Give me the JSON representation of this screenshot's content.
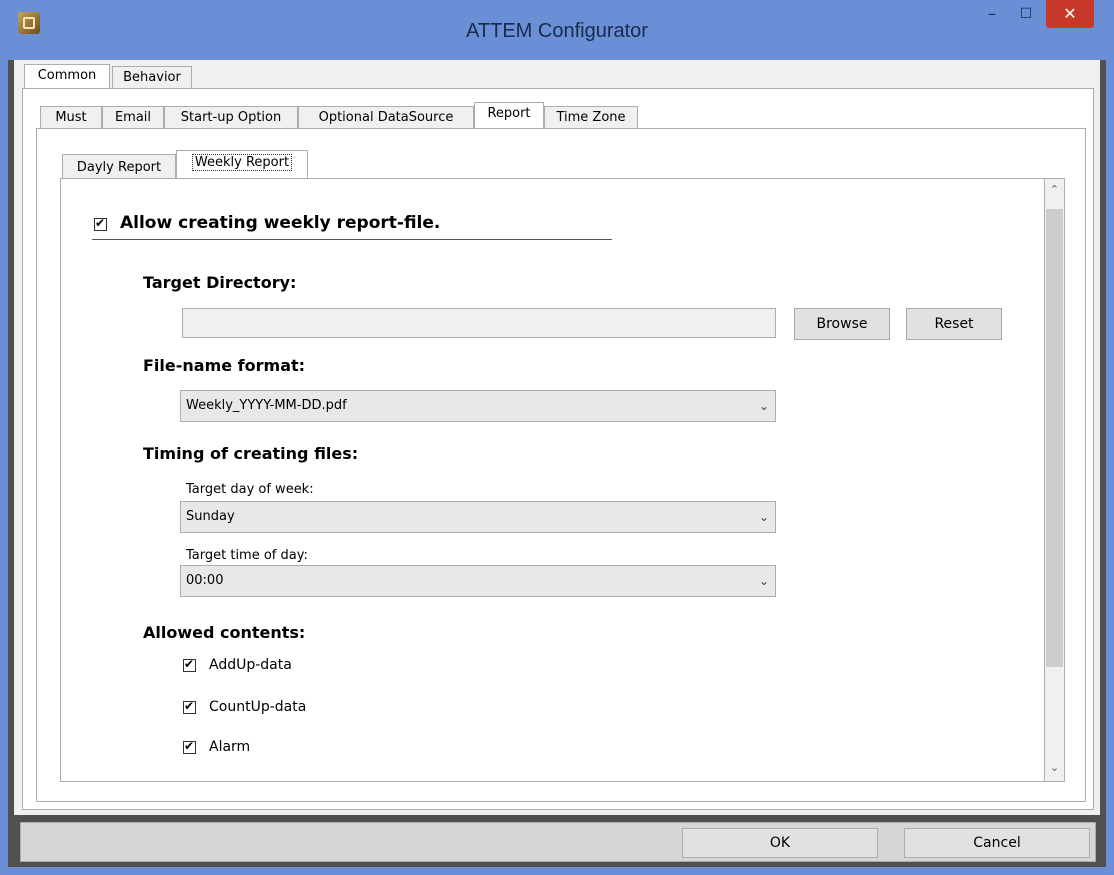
{
  "window": {
    "title": "ATTEM Configurator",
    "minimize_glyph": "–",
    "maximize_glyph": "☐",
    "close_glyph": "✕"
  },
  "top_tabs": [
    "Common",
    "Behavior"
  ],
  "sub_tabs": [
    "Must",
    "Email",
    "Start-up Option",
    "Optional DataSource",
    "Report",
    "Time Zone"
  ],
  "report_tabs": [
    "Dayly Report",
    "Weekly Report"
  ],
  "weekly": {
    "allow_label": "Allow creating weekly report-file.",
    "allow_checked": true,
    "target_directory_heading": "Target Directory:",
    "target_directory_value": "",
    "browse_label": "Browse",
    "reset_label": "Reset",
    "filename_heading": "File-name format:",
    "filename_value": "Weekly_YYYY-MM-DD.pdf",
    "timing_heading": "Timing of creating files:",
    "day_label": "Target day of week:",
    "day_value": "Sunday",
    "time_label": "Target time of day:",
    "time_value": "00:00",
    "contents_heading": "Allowed contents:",
    "contents": [
      {
        "label": "AddUp-data",
        "checked": true
      },
      {
        "label": "CountUp-data",
        "checked": true
      },
      {
        "label": "Alarm",
        "checked": true
      }
    ]
  },
  "footer": {
    "ok_label": "OK",
    "cancel_label": "Cancel"
  },
  "icons": {
    "app": "app-icon",
    "dropdown": "chevron-down-icon",
    "scroll_up": "chevron-up-icon",
    "scroll_down": "chevron-down-icon"
  }
}
